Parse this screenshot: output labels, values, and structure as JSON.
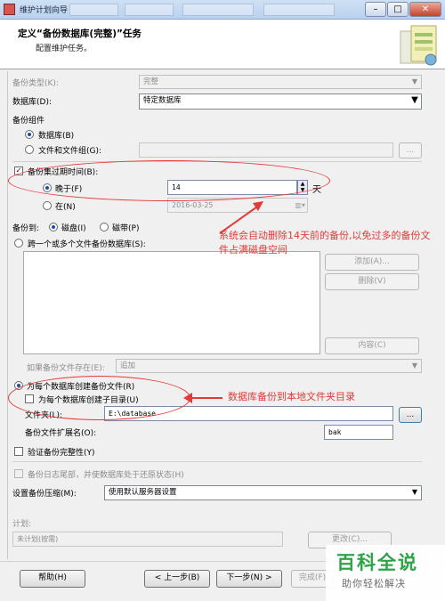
{
  "window": {
    "title": "维护计划向导",
    "controls": [
      "minimize-icon",
      "maximize-icon",
      "close-icon"
    ]
  },
  "header": {
    "title": "定义“备份数据库(完整)”任务",
    "subtitle": "配置维护任务。"
  },
  "backup_type": {
    "label": "备份类型(K):",
    "value": "完整"
  },
  "database": {
    "label": "数据库(D):",
    "value": "特定数据库"
  },
  "backup_component": {
    "label": "备份组件",
    "options": [
      "数据库(B)",
      "文件和文件组(G):"
    ]
  },
  "expire": {
    "checkbox_label": "备份集过期时间(B):",
    "after_label": "晚于(F)",
    "after_value": "14",
    "after_unit": "天",
    "on_label": "在(N)",
    "on_value": "2016-03-25"
  },
  "backup_to": {
    "label": "备份到:",
    "options": [
      "磁盘(I)",
      "磁带(P)"
    ]
  },
  "across_files": {
    "label": "跨一个或多个文件备份数据库(S):"
  },
  "list_buttons": {
    "add": "添加(A)...",
    "remove": "删除(V)",
    "content": "内容(C)"
  },
  "if_exists": {
    "label": "如果备份文件存在(E):",
    "value": "追加"
  },
  "per_db": {
    "option_label": "为每个数据库创建备份文件(R)",
    "subdir_label": "为每个数据库创建子目录(U)",
    "folder_label": "文件夹(L):",
    "folder_value": "E:\\database",
    "ext_label": "备份文件扩展名(O):",
    "ext_value": "bak"
  },
  "verify": {
    "label": "验证备份完整性(Y)"
  },
  "tail_log": {
    "label": "备份日志尾部，并使数据库处于还原状态(H)"
  },
  "compression": {
    "label": "设置备份压缩(M):",
    "value": "使用默认服务器设置"
  },
  "schedule": {
    "label": "计划:",
    "value": "未计划(按需)",
    "change_button": "更改(C)..."
  },
  "footer": {
    "help": "帮助(H)",
    "back": "< 上一步(B)",
    "next": "下一步(N) >",
    "finish": "完成(F)"
  },
  "annotations": {
    "expire_note": "系统会自动删除14天前的备份,以免过多的备份文件占满磁盘空间",
    "folder_note": "数据库备份到本地文件夹目录"
  },
  "watermark": {
    "main": "百科全说",
    "sub": "助你轻松解决"
  },
  "colors": {
    "annotation": "#e53939",
    "watermark": "#2fa347",
    "titlebar": "#b9d1ee"
  }
}
